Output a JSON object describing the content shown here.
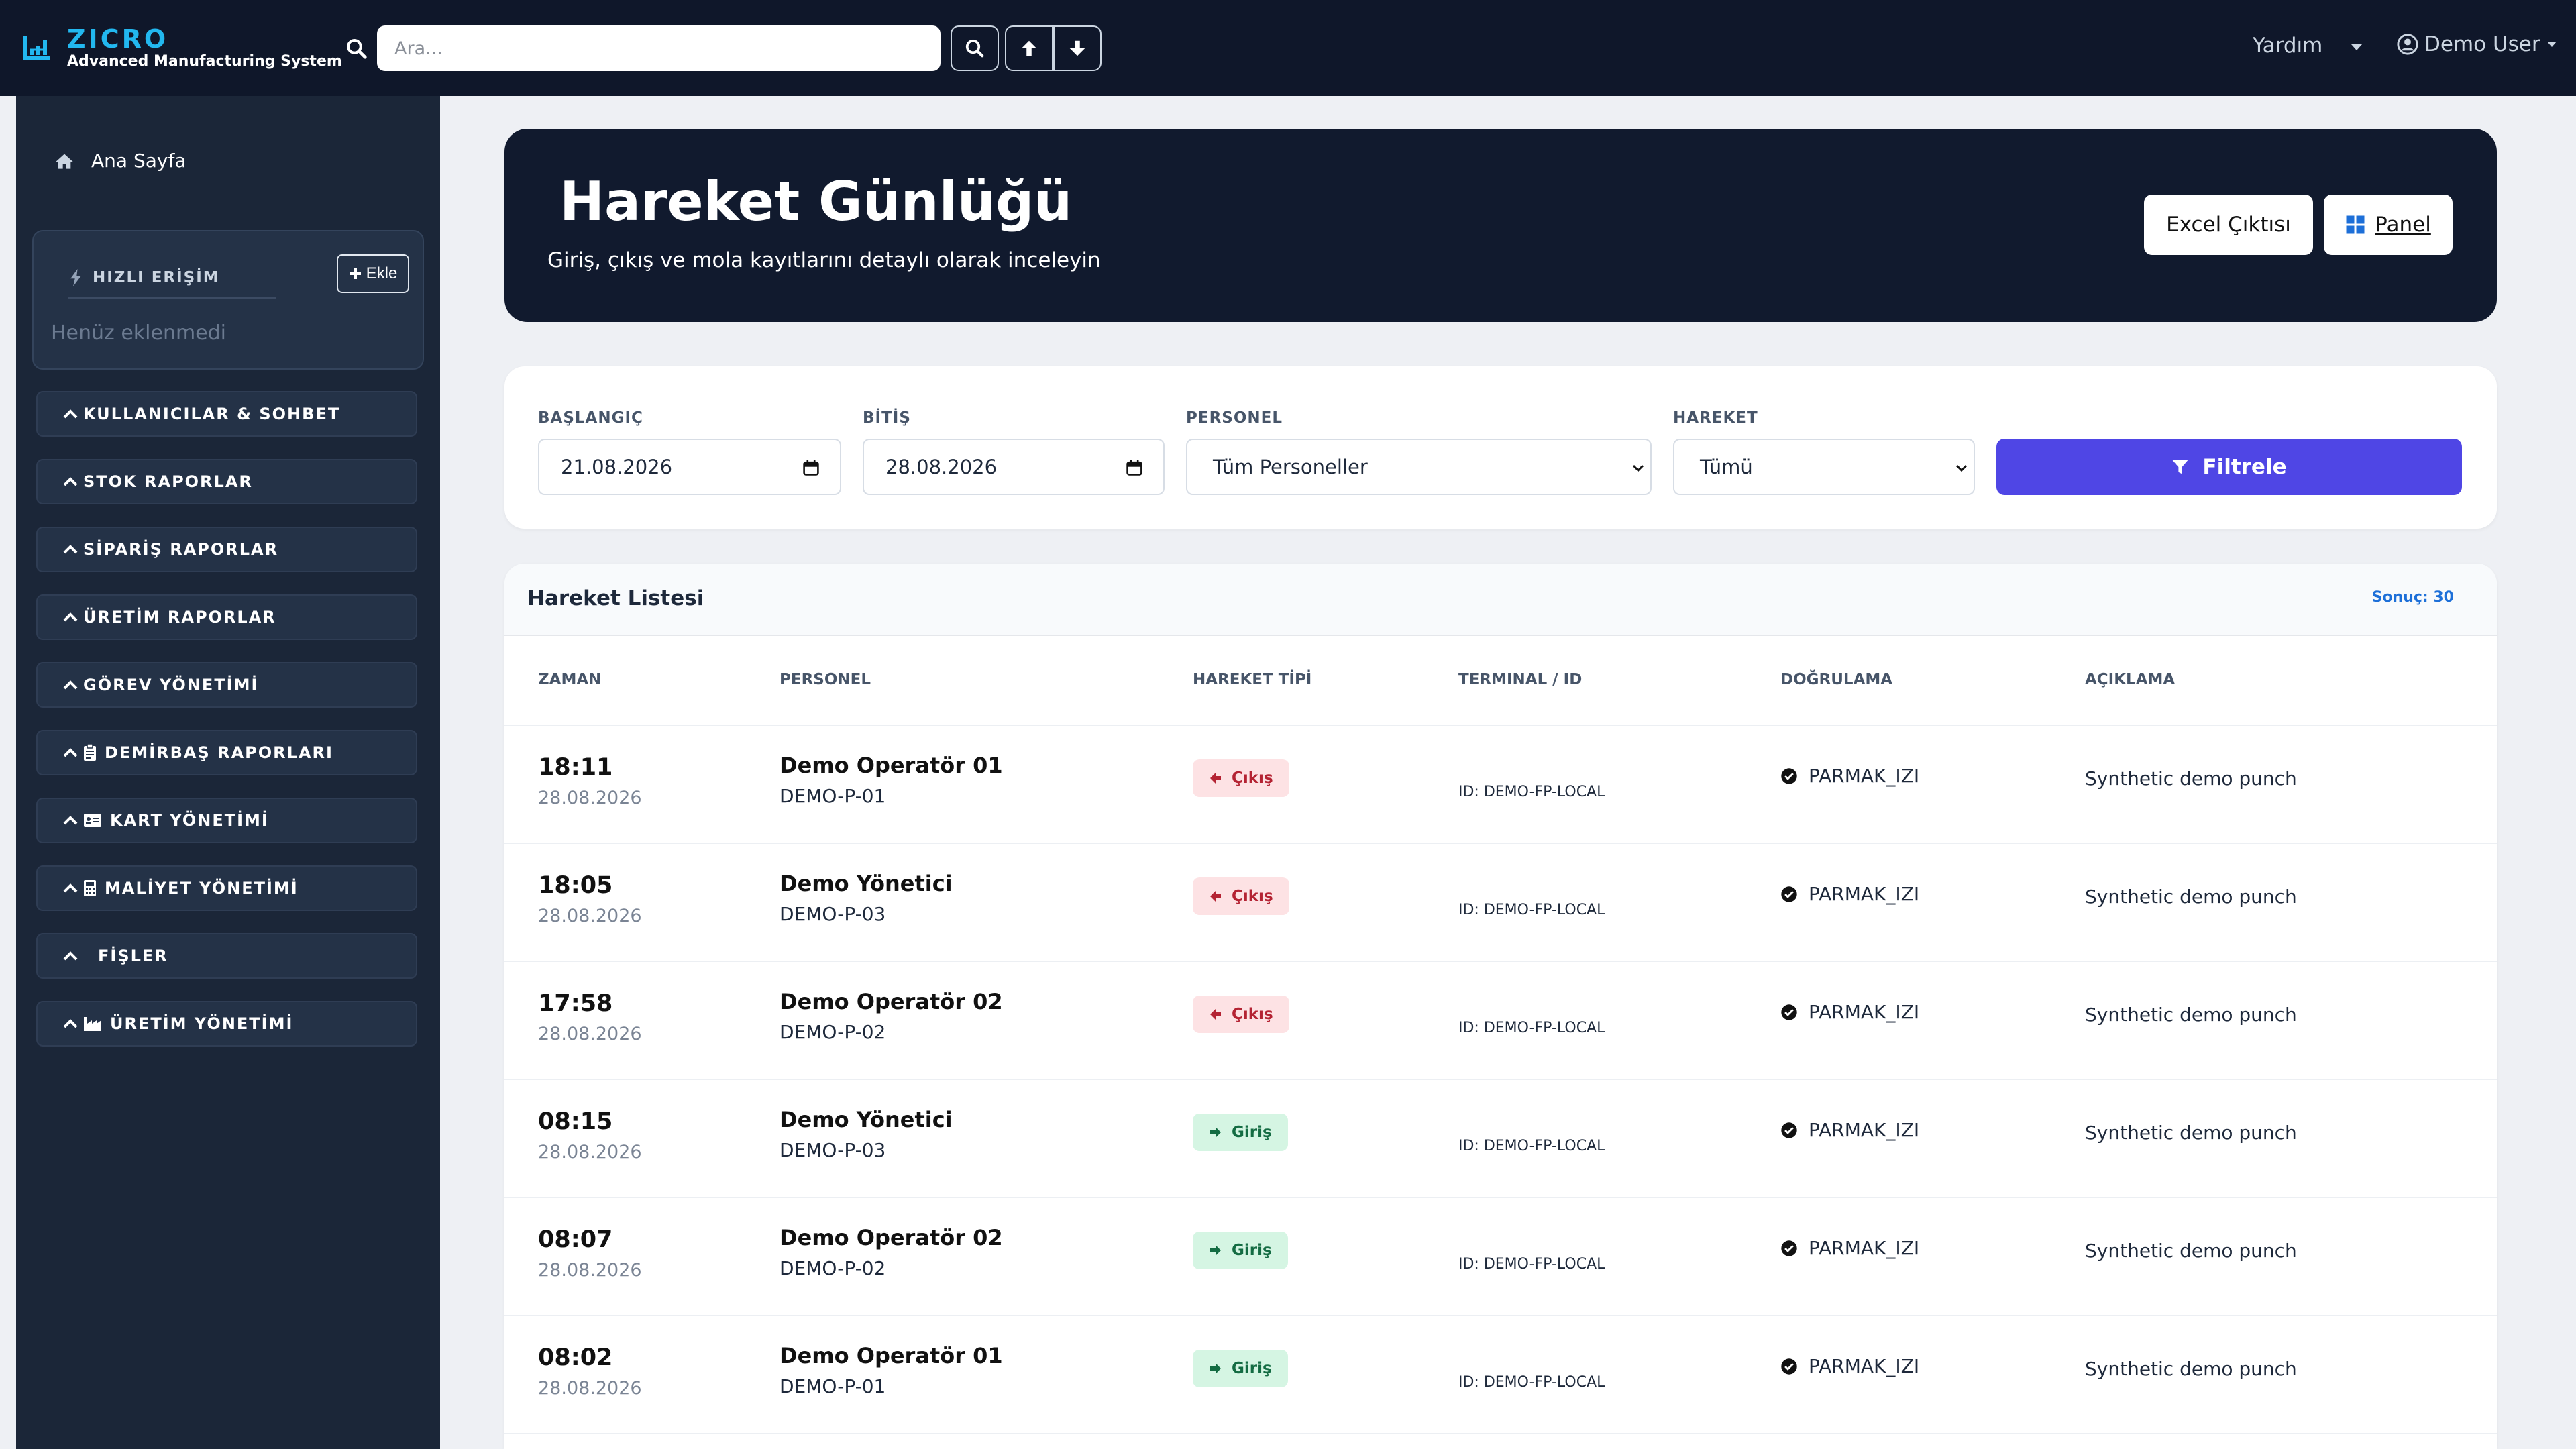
{
  "brand": {
    "name": "ZICRO",
    "subtitle": "Advanced Manufacturing System"
  },
  "search": {
    "placeholder": "Ara..."
  },
  "topnav": {
    "help": "Yardım",
    "user": "Demo User"
  },
  "sidebar": {
    "home": "Ana Sayfa",
    "quick_access": {
      "title": "HIZLI ERİŞİM",
      "add": "Ekle",
      "empty": "Henüz eklenmedi"
    },
    "items": [
      {
        "label": "KULLANICILAR & SOHBET",
        "icon": ""
      },
      {
        "label": "STOK RAPORLAR",
        "icon": ""
      },
      {
        "label": "SİPARİŞ RAPORLAR",
        "icon": ""
      },
      {
        "label": "ÜRETİM RAPORLAR",
        "icon": ""
      },
      {
        "label": "GÖREV YÖNETİMİ",
        "icon": ""
      },
      {
        "label": "DEMİRBAŞ RAPORLARI",
        "icon": "clipboard-icon"
      },
      {
        "label": "KART YÖNETİMİ",
        "icon": "id-card-icon"
      },
      {
        "label": "MALİYET YÖNETİMİ",
        "icon": "calculator-icon"
      },
      {
        "label": "FİŞLER",
        "icon": ""
      },
      {
        "label": "ÜRETİM YÖNETİMİ",
        "icon": "industry-icon"
      }
    ]
  },
  "hero": {
    "title": "Hareket Günlüğü",
    "subtitle": "Giriş, çıkış ve mola kayıtlarını detaylı olarak inceleyin",
    "excel_button": "Excel Çıktısı",
    "panel_button": "Panel"
  },
  "filters": {
    "start_label": "BAŞLANGIÇ",
    "start_value": "21.08.2026",
    "end_label": "BİTİŞ",
    "end_value": "28.08.2026",
    "person_label": "PERSONEL",
    "person_value": "Tüm Personeller",
    "move_label": "HAREKET",
    "move_value": "Tümü",
    "submit": "Filtrele"
  },
  "list": {
    "title": "Hareket Listesi",
    "count": "Sonuç: 30",
    "columns": [
      "ZAMAN",
      "PERSONEL",
      "HAREKET TİPİ",
      "TERMINAL / ID",
      "DOĞRULAMA",
      "AÇIKLAMA"
    ],
    "rows": [
      {
        "time": "18:11",
        "date": "28.08.2026",
        "name": "Demo Operatör 01",
        "pid": "DEMO-P-01",
        "type": "Çıkış",
        "dir": "out",
        "terminal": "ID: DEMO-FP-LOCAL",
        "verify": "PARMAK_IZI",
        "desc": "Synthetic demo punch"
      },
      {
        "time": "18:05",
        "date": "28.08.2026",
        "name": "Demo Yönetici",
        "pid": "DEMO-P-03",
        "type": "Çıkış",
        "dir": "out",
        "terminal": "ID: DEMO-FP-LOCAL",
        "verify": "PARMAK_IZI",
        "desc": "Synthetic demo punch"
      },
      {
        "time": "17:58",
        "date": "28.08.2026",
        "name": "Demo Operatör 02",
        "pid": "DEMO-P-02",
        "type": "Çıkış",
        "dir": "out",
        "terminal": "ID: DEMO-FP-LOCAL",
        "verify": "PARMAK_IZI",
        "desc": "Synthetic demo punch"
      },
      {
        "time": "08:15",
        "date": "28.08.2026",
        "name": "Demo Yönetici",
        "pid": "DEMO-P-03",
        "type": "Giriş",
        "dir": "in",
        "terminal": "ID: DEMO-FP-LOCAL",
        "verify": "PARMAK_IZI",
        "desc": "Synthetic demo punch"
      },
      {
        "time": "08:07",
        "date": "28.08.2026",
        "name": "Demo Operatör 02",
        "pid": "DEMO-P-02",
        "type": "Giriş",
        "dir": "in",
        "terminal": "ID: DEMO-FP-LOCAL",
        "verify": "PARMAK_IZI",
        "desc": "Synthetic demo punch"
      },
      {
        "time": "08:02",
        "date": "28.08.2026",
        "name": "Demo Operatör 01",
        "pid": "DEMO-P-01",
        "type": "Giriş",
        "dir": "in",
        "terminal": "ID: DEMO-FP-LOCAL",
        "verify": "PARMAK_IZI",
        "desc": "Synthetic demo punch"
      }
    ]
  },
  "colors": {
    "navbar": "#0f172a",
    "sidebar": "#1b2638",
    "accent": "#4f46e5",
    "brand": "#22b8f0",
    "out_badge": "#fde2e4",
    "in_badge": "#d5f5e3"
  }
}
